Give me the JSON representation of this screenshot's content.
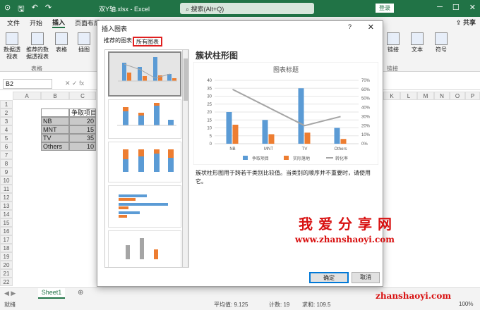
{
  "app": {
    "title": "双Y轴.xlsx - Excel",
    "search_placeholder": "搜索(Alt+Q)",
    "login": "登录",
    "share": "共享"
  },
  "tabs": [
    "文件",
    "开始",
    "插入",
    "页面布局"
  ],
  "active_tab": "插入",
  "ribbon": {
    "buttons": [
      "数据透视表",
      "推荐的数据透视表",
      "表格",
      "插图",
      "链接",
      "文本",
      "符号"
    ],
    "groups": [
      "表格",
      "链接"
    ]
  },
  "formula": {
    "namebox": "B2"
  },
  "sheet": {
    "columns": [
      "A",
      "B",
      "C"
    ],
    "rows": [
      "1",
      "2",
      "3",
      "4",
      "5",
      "6",
      "7",
      "8",
      "9",
      "10",
      "11",
      "12",
      "13",
      "14",
      "15",
      "16",
      "17",
      "18",
      "19",
      "20",
      "21",
      "22"
    ],
    "header_cell": "争取项目",
    "labels": [
      "NB",
      "MNT",
      "TV",
      "Others"
    ],
    "values": [
      "20",
      "15",
      "35",
      "10"
    ],
    "right_columns": [
      "K",
      "L",
      "M",
      "N",
      "O",
      "P"
    ]
  },
  "sheet_tab": "Sheet1",
  "status": {
    "left": "就绪",
    "avg": "平均值: 9.125",
    "count": "计数: 19",
    "sum": "求和: 109.5",
    "zoom": "100%"
  },
  "dialog": {
    "title": "插入图表",
    "help": "?",
    "close": "✕",
    "tab_recommended": "推荐的图表",
    "tab_all": "所有图表",
    "preview_title": "簇状柱形图",
    "description": "簇状柱形图用于跨若干类别比较值。当类别的顺序并不重要时，请使用它。",
    "ok": "确定",
    "cancel": "取消"
  },
  "chart_data": {
    "type": "bar",
    "title": "图表标题",
    "categories": [
      "NB",
      "MNT",
      "TV",
      "Others"
    ],
    "series": [
      {
        "name": "争取项目",
        "values": [
          20,
          15,
          35,
          10
        ],
        "color": "#5b9bd5"
      },
      {
        "name": "实际落地",
        "values": [
          12,
          6,
          7,
          3
        ],
        "color": "#ed7d31"
      },
      {
        "name": "转化率",
        "values": [
          0.6,
          0.4,
          0.2,
          0.3
        ],
        "color": "#a5a5a5",
        "axis": "secondary",
        "kind": "line"
      }
    ],
    "y_ticks": [
      "0",
      "5",
      "10",
      "15",
      "20",
      "25",
      "30",
      "35",
      "40"
    ],
    "y2_ticks": [
      "0%",
      "10%",
      "20%",
      "30%",
      "40%",
      "50%",
      "60%",
      "70%"
    ],
    "ylim": [
      0,
      40
    ],
    "y2lim": [
      0,
      0.7
    ]
  },
  "watermark": {
    "text": "我爱分享网",
    "url": "www.zhanshaoyi.com",
    "url2": "zhanshaoyi.com"
  },
  "colors": {
    "excel_green": "#217346",
    "selected_tab_border": "#e02020"
  }
}
